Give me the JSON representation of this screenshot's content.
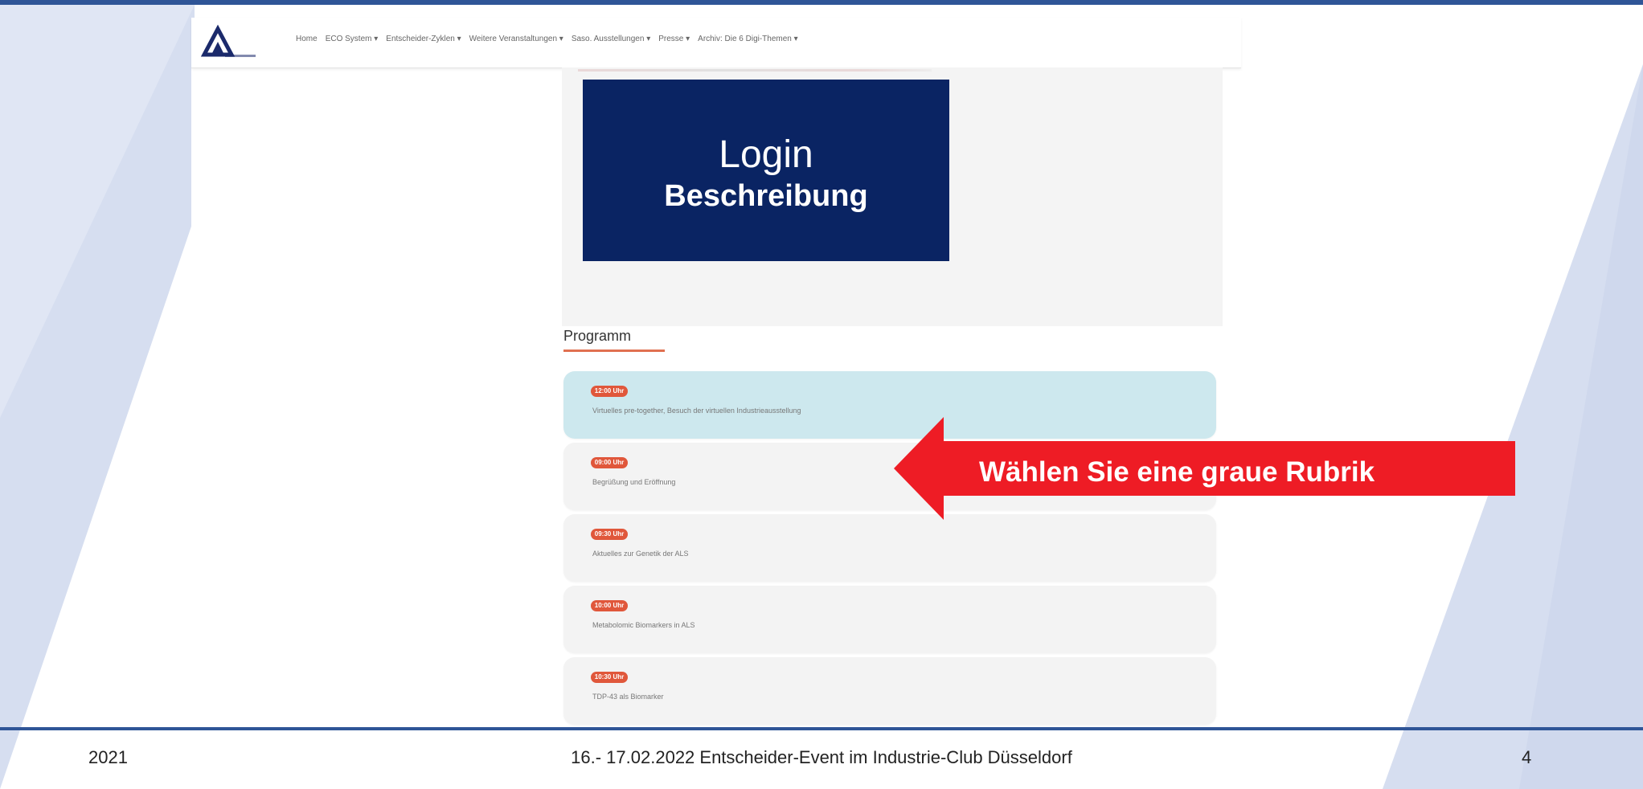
{
  "colors": {
    "accent_blue": "#2f5597",
    "login_bg": "#0a2463",
    "badge": "#e0573b",
    "callout_red": "#ee1c25",
    "active_item": "#cde8ee"
  },
  "nav": {
    "items": [
      "Home",
      "ECO System ▾",
      "Entscheider-Zyklen ▾",
      "Weitere Veranstaltungen ▾",
      "Saso. Ausstellungen ▾",
      "Presse ▾",
      "Archiv: Die 6 Digi-Themen ▾"
    ]
  },
  "login": {
    "title": "Login",
    "subtitle": "Beschreibung"
  },
  "programm": {
    "heading": "Programm",
    "items": [
      {
        "time": "12:00 Uhr",
        "text": "Virtuelles pre-together, Besuch der virtuellen Industrieausstellung",
        "active": true
      },
      {
        "time": "09:00 Uhr",
        "text": "Begrüßung und Eröffnung",
        "active": false
      },
      {
        "time": "09:30 Uhr",
        "text": "Aktuelles zur Genetik der ALS",
        "active": false
      },
      {
        "time": "10:00 Uhr",
        "text": "Metabolomic Biomarkers in ALS",
        "active": false
      },
      {
        "time": "10:30 Uhr",
        "text": "TDP-43 als Biomarker",
        "active": false
      }
    ]
  },
  "callout": {
    "text": "Wählen Sie eine graue Rubrik",
    "icon": "arrow-left-icon"
  },
  "footer": {
    "year": "2021",
    "title": "16.- 17.02.2022 Entscheider-Event im Industrie-Club Düsseldorf",
    "page": "4"
  }
}
